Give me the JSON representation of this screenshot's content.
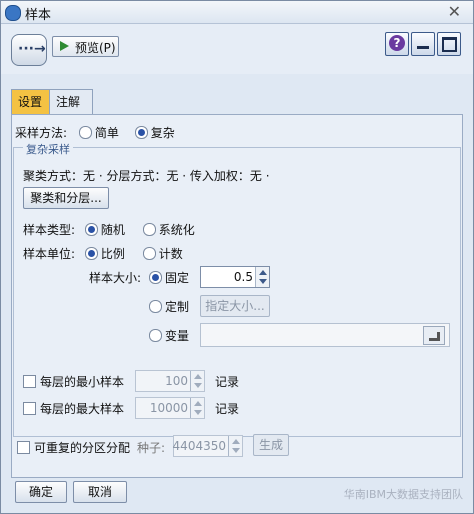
{
  "window": {
    "title": "样本"
  },
  "toolbar": {
    "preview_label": "预览(P)",
    "help_label": "?"
  },
  "tabs": [
    {
      "label": "设置"
    },
    {
      "label": "注解"
    }
  ],
  "sampling": {
    "method_label": "采样方法:",
    "method_simple": "简单",
    "method_complex": "复杂",
    "selected_method": "复杂"
  },
  "complex": {
    "group_title": "复杂采样",
    "summary": "聚类方式：无 · 分层方式：无 · 传入加权：无 ·",
    "cluster_button": "聚类和分层...",
    "sample_type_label": "样本类型:",
    "type_random": "随机",
    "type_systematic": "系统化",
    "sample_units_label": "样本单位:",
    "units_proportion": "比例",
    "units_count": "计数",
    "sample_size_label": "样本大小:",
    "size_fixed": "固定",
    "size_fixed_value": "0.5",
    "size_custom": "定制",
    "specify_button": "指定大小...",
    "size_variable": "变量",
    "min_per_stratum_label": "每层的最小样本",
    "min_per_stratum_value": "100",
    "max_per_stratum_label": "每层的最大样本",
    "max_per_stratum_value": "10000",
    "records_label": "记录"
  },
  "repeatable": {
    "label": "可重复的分区分配",
    "seed_label": "种子:",
    "seed_value": "4404350",
    "generate_button": "生成"
  },
  "footer": {
    "ok_label": "确定",
    "cancel_label": "取消"
  },
  "watermark": {
    "text": "华南IBM大数据支持团队"
  },
  "colors": {
    "active_tab": "#f4c243",
    "panel": "#e9eff7",
    "accent": "#2a52a6"
  }
}
